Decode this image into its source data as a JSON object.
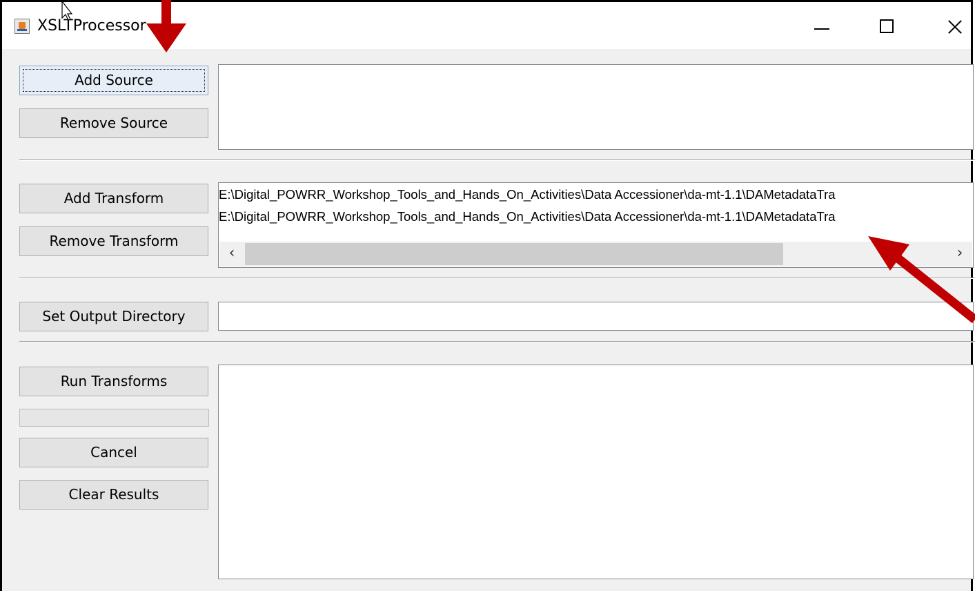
{
  "window": {
    "title": "XSLTProcessor"
  },
  "buttons": {
    "add_source": "Add Source",
    "remove_source": "Remove Source",
    "add_transform": "Add Transform",
    "remove_transform": "Remove Transform",
    "set_output_directory": "Set Output Directory",
    "run_transforms": "Run Transforms",
    "cancel": "Cancel",
    "clear_results": "Clear Results"
  },
  "source_list": {
    "items": []
  },
  "transform_list": {
    "items": [
      "E:\\Digital_POWRR_Workshop_Tools_and_Hands_On_Activities\\Data Accessioner\\da-mt-1.1\\DAMetadataTra",
      "E:\\Digital_POWRR_Workshop_Tools_and_Hands_On_Activities\\Data Accessioner\\da-mt-1.1\\DAMetadataTra"
    ]
  },
  "output_directory": {
    "value": ""
  },
  "progress": {
    "fraction": 0
  },
  "results": {
    "text": ""
  },
  "colors": {
    "annotation_arrow": "#c00000",
    "window_bg": "#f0f0f0",
    "field_bg": "#ffffff"
  },
  "icons": {
    "app": "java-coffee-icon",
    "minimize": "minimize-icon",
    "maximize": "maximize-icon",
    "close": "close-icon",
    "scroll_left": "chevron-left-icon",
    "scroll_right": "chevron-right-icon"
  }
}
